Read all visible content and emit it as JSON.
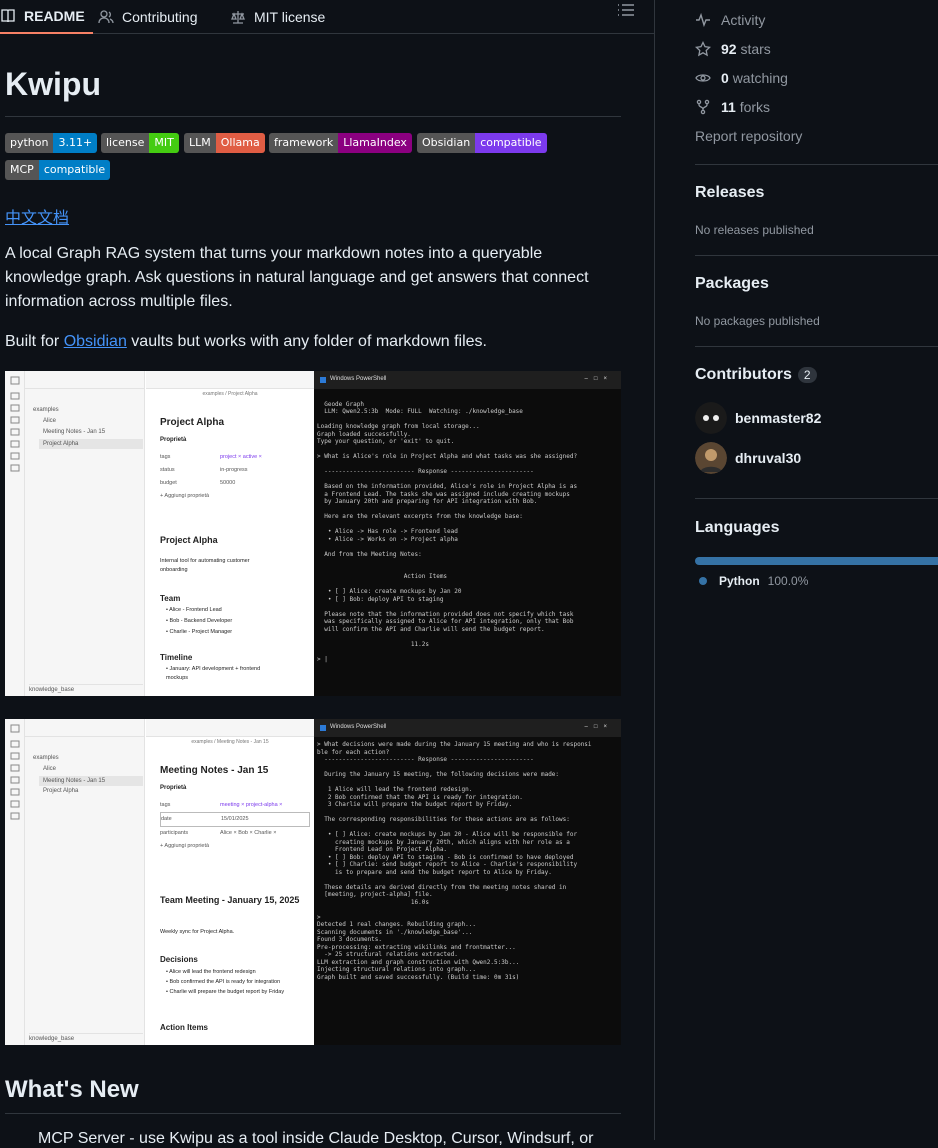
{
  "tabs": {
    "readme": "README",
    "contributing": "Contributing",
    "license": "MIT license"
  },
  "readme": {
    "title": "Kwipu",
    "badges": [
      {
        "k": "python",
        "v": "3.11+",
        "color": "#007ec6"
      },
      {
        "k": "license",
        "v": "MIT",
        "color": "#4c1"
      },
      {
        "k": "LLM",
        "v": "Ollama",
        "color": "#e05d44"
      },
      {
        "k": "framework",
        "v": "LlamaIndex",
        "color": "#8b0080"
      },
      {
        "k": "Obsidian",
        "v": "compatible",
        "color": "#7c3aed"
      },
      {
        "k": "MCP",
        "v": "compatible",
        "color": "#007ec6"
      }
    ],
    "chinese_link": "中文文档",
    "description": "A local Graph RAG system that turns your markdown notes into a queryable knowledge graph. Ask questions in natural language and get answers that connect information across multiple files.",
    "built_for_prefix": "Built for ",
    "built_for_link": "Obsidian",
    "built_for_suffix": " vaults but works with any folder of markdown files.",
    "whats_new": "What's New",
    "bullet_cut": "MCP Server - use Kwipu as a tool inside Claude Desktop, Cursor, Windsurf, or"
  },
  "screenshot1": {
    "tree": [
      "examples",
      "Alice",
      "Meeting Notes - Jan 15",
      "Project Alpha"
    ],
    "vault": "knowledge_base",
    "note_breadcrumb": "examples / Project Alpha",
    "note_title": "Project Alpha",
    "props_label": "Proprietà",
    "props": [
      {
        "k": "tags",
        "v": "project ×  active ×"
      },
      {
        "k": "status",
        "v": "in-progress"
      },
      {
        "k": "budget",
        "v": "50000"
      }
    ],
    "add_prop": "+ Aggiungi proprietà",
    "h1": "Project Alpha",
    "intro": "Internal tool for automating customer onboarding",
    "team_h": "Team",
    "team": [
      "Alice - Frontend Lead",
      "Bob - Backend Developer",
      "Charlie - Project Manager"
    ],
    "timeline_h": "Timeline",
    "timeline": [
      "January: API development + frontend mockups"
    ],
    "term_title": "Windows PowerShell",
    "term_lines": [
      "",
      "  Geode Graph",
      "  LLM: Qwen2.5:3b  Mode: FULL  Watching: ./knowledge_base",
      "",
      "Loading knowledge graph from local storage...",
      "Graph loaded successfully.",
      "Type your question, or 'exit' to quit.",
      "",
      "> What is Alice's role in Project Alpha and what tasks was she assigned?",
      "",
      "  ------------------------- Response -----------------------",
      "",
      "  Based on the information provided, Alice's role in Project Alpha is as",
      "  a Frontend Lead. The tasks she was assigned include creating mockups",
      "  by January 20th and preparing for API integration with Bob.",
      "",
      "  Here are the relevant excerpts from the knowledge base:",
      "",
      "   • Alice -> Has role -> Frontend lead",
      "   • Alice -> Works on -> Project alpha",
      "",
      "  And from the Meeting Notes:",
      "",
      "",
      "                        Action Items",
      "",
      "   • [ ] Alice: create mockups by Jan 20",
      "   • [ ] Bob: deploy API to staging",
      "",
      "  Please note that the information provided does not specify which task",
      "  was specifically assigned to Alice for API integration, only that Bob",
      "  will confirm the API and Charlie will send the budget report.",
      "",
      "                          11.2s",
      "",
      "> |"
    ]
  },
  "screenshot2": {
    "tree": [
      "examples",
      "Alice",
      "Meeting Notes - Jan 15",
      "Project Alpha"
    ],
    "vault": "knowledge_base",
    "note_breadcrumb": "examples / Meeting Notes - Jan 15",
    "note_title": "Meeting Notes - Jan 15",
    "props_label": "Proprietà",
    "props": [
      {
        "k": "tags",
        "v": "meeting ×  project-alpha ×"
      },
      {
        "k": "date",
        "v": "15/01/2025"
      },
      {
        "k": "participants",
        "v": "Alice ×  Bob ×  Charlie ×"
      }
    ],
    "add_prop": "+ Aggiungi proprietà",
    "h1": "Team Meeting - January 15, 2025",
    "intro": "Weekly sync for Project Alpha.",
    "decisions_h": "Decisions",
    "decisions": [
      "Alice will lead the frontend redesign",
      "Bob confirmed the API is ready for integration",
      "Charlie will prepare the budget report by Friday"
    ],
    "actions_h": "Action Items",
    "term_title": "Windows PowerShell",
    "term_lines": [
      "> What decisions were made during the January 15 meeting and who is responsi",
      "ble for each action?",
      "  ------------------------- Response -----------------------",
      "",
      "  During the January 15 meeting, the following decisions were made:",
      "",
      "   1 Alice will lead the frontend redesign.",
      "   2 Bob confirmed that the API is ready for integration.",
      "   3 Charlie will prepare the budget report by Friday.",
      "",
      "  The corresponding responsibilities for these actions are as follows:",
      "",
      "   • [ ] Alice: create mockups by Jan 20 - Alice will be responsible for",
      "     creating mockups by January 20th, which aligns with her role as a",
      "     Frontend Lead on Project Alpha.",
      "   • [ ] Bob: deploy API to staging - Bob is confirmed to have deployed",
      "   • [ ] Charlie: send budget report to Alice - Charlie's responsibility",
      "     is to prepare and send the budget report to Alice by Friday.",
      "",
      "  These details are derived directly from the meeting notes shared in",
      "  [meeting, project-alpha] file.",
      "                          16.0s",
      "",
      ">",
      "Detected 1 real changes. Rebuilding graph...",
      "Scanning documents in './knowledge_base'...",
      "Found 3 documents.",
      "Pre-processing: extracting wikilinks and frontmatter...",
      "  -> 25 structural relations extracted.",
      "LLM extraction and graph construction with Qwen2.5:3b...",
      "Injecting structural relations into graph...",
      "Graph built and saved successfully. (Build time: 0m 31s)"
    ]
  },
  "sidebar": {
    "activity": "Activity",
    "stars_n": "92",
    "stars": "stars",
    "watching_n": "0",
    "watching": "watching",
    "forks_n": "11",
    "forks": "forks",
    "report": "Report repository",
    "releases_h": "Releases",
    "releases_none": "No releases published",
    "packages_h": "Packages",
    "packages_none": "No packages published",
    "contributors_h": "Contributors",
    "contributors_count": "2",
    "contributors": [
      "benmaster82",
      "dhruval30"
    ],
    "languages_h": "Languages",
    "lang_name": "Python",
    "lang_pct": "100.0%",
    "lang_color": "#3572A5"
  }
}
